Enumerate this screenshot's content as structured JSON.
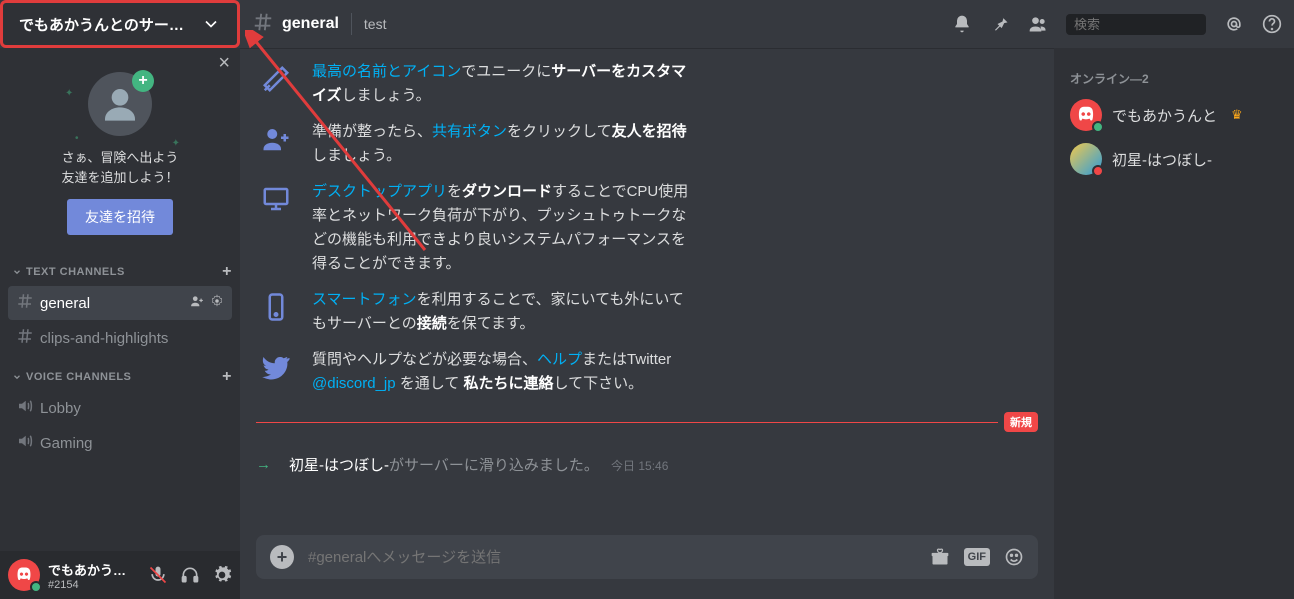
{
  "server": {
    "name": "でもあかうんとのサー…"
  },
  "channelHeader": {
    "name": "general",
    "topic": "test"
  },
  "search": {
    "placeholder": "検索"
  },
  "invitePanel": {
    "line1": "さぁ、冒険へ出よう",
    "line2": "友達を追加しよう！",
    "button": "友達を招待"
  },
  "categories": {
    "text": {
      "label": "TEXT CHANNELS"
    },
    "voice": {
      "label": "VOICE CHANNELS"
    }
  },
  "textChannels": [
    {
      "name": "general"
    },
    {
      "name": "clips-and-highlights"
    }
  ],
  "voiceChannels": [
    {
      "name": "Lobby"
    },
    {
      "name": "Gaming"
    }
  ],
  "currentUser": {
    "name": "でもあかう…",
    "tag": "#2154"
  },
  "welcome": [
    {
      "icon": "pen",
      "parts": [
        {
          "t": "最高の名前とアイコン",
          "k": "link"
        },
        {
          "t": "でユニークに"
        },
        {
          "t": "サーバーをカスタマイズ",
          "k": "bold"
        },
        {
          "t": "しましょう。"
        }
      ]
    },
    {
      "icon": "addfriend",
      "parts": [
        {
          "t": "準備が整ったら、"
        },
        {
          "t": "共有ボタン",
          "k": "link"
        },
        {
          "t": "をクリックして"
        },
        {
          "t": "友人を招待",
          "k": "bold"
        },
        {
          "t": "しましょう。"
        }
      ]
    },
    {
      "icon": "desktop",
      "parts": [
        {
          "t": "デスクトップアプリ",
          "k": "link"
        },
        {
          "t": "を"
        },
        {
          "t": "ダウンロード",
          "k": "bold"
        },
        {
          "t": "することでCPU使用率とネットワーク負荷が下がり、プッシュトゥトークなどの機能も利用できより良いシステムパフォーマンスを得ることができます。"
        }
      ]
    },
    {
      "icon": "phone",
      "parts": [
        {
          "t": "スマートフォン",
          "k": "link"
        },
        {
          "t": "を利用することで、家にいても外にいてもサーバーとの"
        },
        {
          "t": "接続",
          "k": "bold"
        },
        {
          "t": "を保てます。"
        }
      ]
    },
    {
      "icon": "twitter",
      "parts": [
        {
          "t": "質問やヘルプなどが必要な場合、"
        },
        {
          "t": "ヘルプ",
          "k": "link"
        },
        {
          "t": "またはTwitter "
        },
        {
          "t": "@discord_jp",
          "k": "link"
        },
        {
          "t": " を通して "
        },
        {
          "t": "私たちに連絡",
          "k": "bold"
        },
        {
          "t": "して下さい。"
        }
      ]
    }
  ],
  "newDivider": {
    "label": "新規"
  },
  "joinMessage": {
    "name": "初星-はつぼし-",
    "text": "がサーバーに滑り込みました。",
    "time": "今日 15:46"
  },
  "composer": {
    "placeholder": "#generalへメッセージを送信"
  },
  "membersPanel": {
    "header": "オンライン—2",
    "members": [
      {
        "name": "でもあかうんと",
        "owner": true,
        "status": "online",
        "avatar": "discord"
      },
      {
        "name": "初星-はつぼし-",
        "owner": false,
        "status": "dnd",
        "avatar": "custom"
      }
    ]
  }
}
